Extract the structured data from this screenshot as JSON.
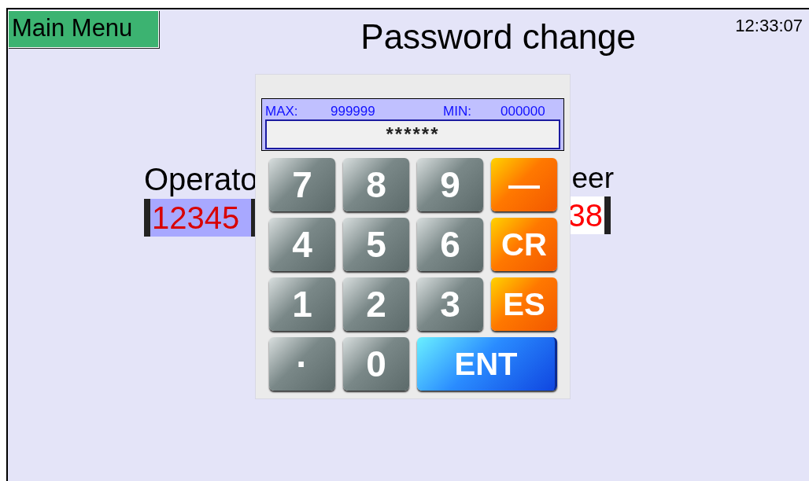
{
  "header": {
    "main_menu_button": "Main Menu",
    "title": "Password change",
    "time": "12:33:07"
  },
  "form": {
    "left_label": "Operato",
    "right_label": "eer",
    "left_value": "12345",
    "left_value_selected": true,
    "right_value": "38",
    "right_value_selected": false
  },
  "keypad": {
    "max_label": "MAX:",
    "max_value": "999999",
    "min_label": "MIN:",
    "min_value": "000000",
    "entry": "******",
    "keys": [
      {
        "label": "7",
        "kind": "digit"
      },
      {
        "label": "8",
        "kind": "digit"
      },
      {
        "label": "9",
        "kind": "digit"
      },
      {
        "label": "—",
        "kind": "function"
      },
      {
        "label": "4",
        "kind": "digit"
      },
      {
        "label": "5",
        "kind": "digit"
      },
      {
        "label": "6",
        "kind": "digit"
      },
      {
        "label": "CR",
        "kind": "function"
      },
      {
        "label": "1",
        "kind": "digit"
      },
      {
        "label": "2",
        "kind": "digit"
      },
      {
        "label": "3",
        "kind": "digit"
      },
      {
        "label": "ES",
        "kind": "function"
      },
      {
        "label": "·",
        "kind": "digit"
      },
      {
        "label": "0",
        "kind": "digit"
      },
      {
        "label": "ENT",
        "kind": "enter"
      }
    ]
  }
}
